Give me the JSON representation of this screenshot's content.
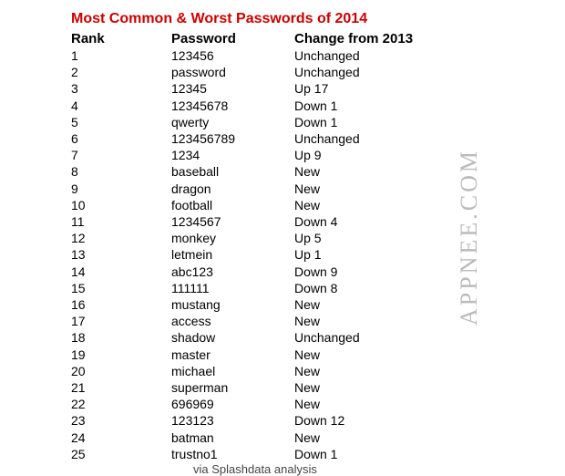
{
  "title": "Most Common & Worst Passwords of 2014",
  "headers": {
    "rank": "Rank",
    "password": "Password",
    "change": "Change from 2013"
  },
  "rows": [
    {
      "rank": "1",
      "password": "123456",
      "change": "Unchanged"
    },
    {
      "rank": "2",
      "password": "password",
      "change": "Unchanged"
    },
    {
      "rank": "3",
      "password": "12345",
      "change": "Up 17"
    },
    {
      "rank": "4",
      "password": "12345678",
      "change": "Down 1"
    },
    {
      "rank": "5",
      "password": "qwerty",
      "change": "Down 1"
    },
    {
      "rank": "6",
      "password": "123456789",
      "change": "Unchanged"
    },
    {
      "rank": "7",
      "password": "1234",
      "change": "Up 9"
    },
    {
      "rank": "8",
      "password": "baseball",
      "change": "New"
    },
    {
      "rank": "9",
      "password": "dragon",
      "change": "New"
    },
    {
      "rank": "10",
      "password": "football",
      "change": "New"
    },
    {
      "rank": "11",
      "password": "1234567",
      "change": "Down 4"
    },
    {
      "rank": "12",
      "password": "monkey",
      "change": "Up 5"
    },
    {
      "rank": "13",
      "password": "letmein",
      "change": "Up 1"
    },
    {
      "rank": "14",
      "password": "abc123",
      "change": "Down 9"
    },
    {
      "rank": "15",
      "password": "111111",
      "change": "Down 8"
    },
    {
      "rank": "16",
      "password": "mustang",
      "change": "New"
    },
    {
      "rank": "17",
      "password": "access",
      "change": "New"
    },
    {
      "rank": "18",
      "password": "shadow",
      "change": "Unchanged"
    },
    {
      "rank": "19",
      "password": "master",
      "change": "New"
    },
    {
      "rank": "20",
      "password": "michael",
      "change": "New"
    },
    {
      "rank": "21",
      "password": "superman",
      "change": "New"
    },
    {
      "rank": "22",
      "password": "696969",
      "change": "New"
    },
    {
      "rank": "23",
      "password": "123123",
      "change": "Down 12"
    },
    {
      "rank": "24",
      "password": "batman",
      "change": "New"
    },
    {
      "rank": "25",
      "password": "trustno1",
      "change": "Down 1"
    }
  ],
  "footer": "via Splashdata analysis",
  "watermark": "APPNEE.COM",
  "chart_data": {
    "type": "table",
    "title": "Most Common & Worst Passwords of 2014",
    "columns": [
      "Rank",
      "Password",
      "Change from 2013"
    ],
    "data": [
      [
        1,
        "123456",
        "Unchanged"
      ],
      [
        2,
        "password",
        "Unchanged"
      ],
      [
        3,
        "12345",
        "Up 17"
      ],
      [
        4,
        "12345678",
        "Down 1"
      ],
      [
        5,
        "qwerty",
        "Down 1"
      ],
      [
        6,
        "123456789",
        "Unchanged"
      ],
      [
        7,
        "1234",
        "Up 9"
      ],
      [
        8,
        "baseball",
        "New"
      ],
      [
        9,
        "dragon",
        "New"
      ],
      [
        10,
        "football",
        "New"
      ],
      [
        11,
        "1234567",
        "Down 4"
      ],
      [
        12,
        "monkey",
        "Up 5"
      ],
      [
        13,
        "letmein",
        "Up 1"
      ],
      [
        14,
        "abc123",
        "Down 9"
      ],
      [
        15,
        "111111",
        "Down 8"
      ],
      [
        16,
        "mustang",
        "New"
      ],
      [
        17,
        "access",
        "New"
      ],
      [
        18,
        "shadow",
        "Unchanged"
      ],
      [
        19,
        "master",
        "New"
      ],
      [
        20,
        "michael",
        "New"
      ],
      [
        21,
        "superman",
        "New"
      ],
      [
        22,
        "696969",
        "New"
      ],
      [
        23,
        "123123",
        "Down 12"
      ],
      [
        24,
        "batman",
        "New"
      ],
      [
        25,
        "trustno1",
        "Down 1"
      ]
    ]
  }
}
